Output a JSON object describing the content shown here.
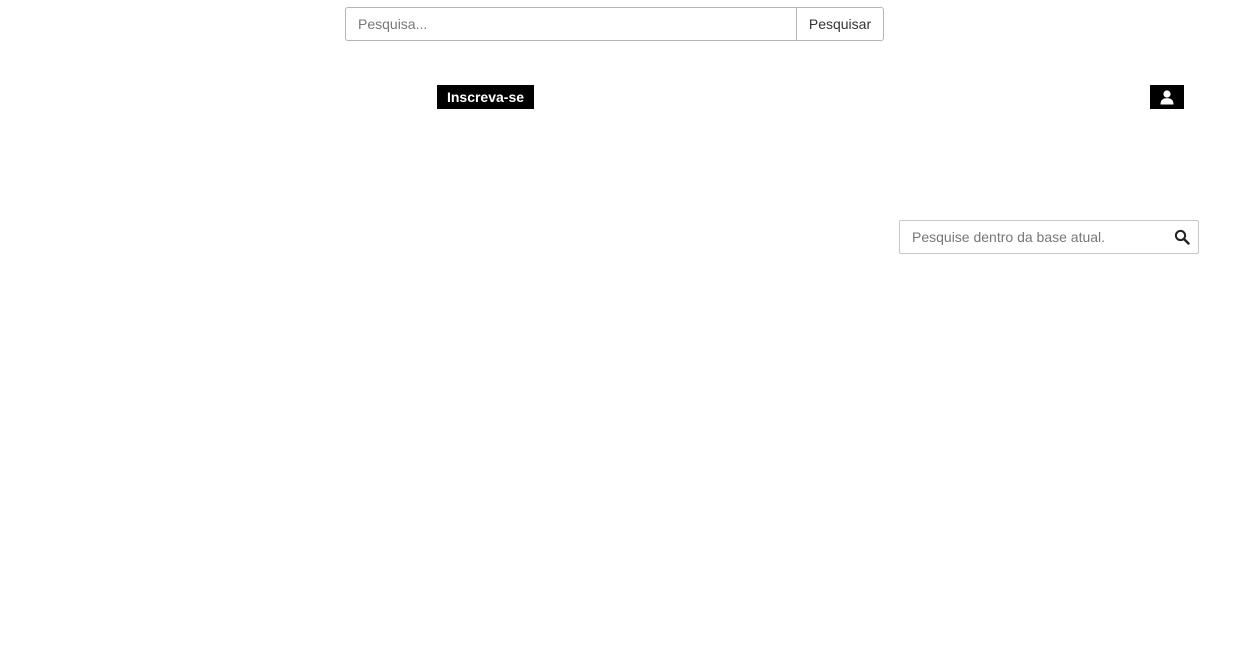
{
  "header": {
    "search": {
      "placeholder": "Pesquisa...",
      "value": "",
      "button_label": "Pesquisar"
    },
    "subscribe_label": "Inscreva-se",
    "user_icon": "user-icon"
  },
  "sidebar": {
    "search": {
      "placeholder": "Pesquise dentro da base atual.",
      "value": "",
      "icon": "search-icon"
    }
  }
}
